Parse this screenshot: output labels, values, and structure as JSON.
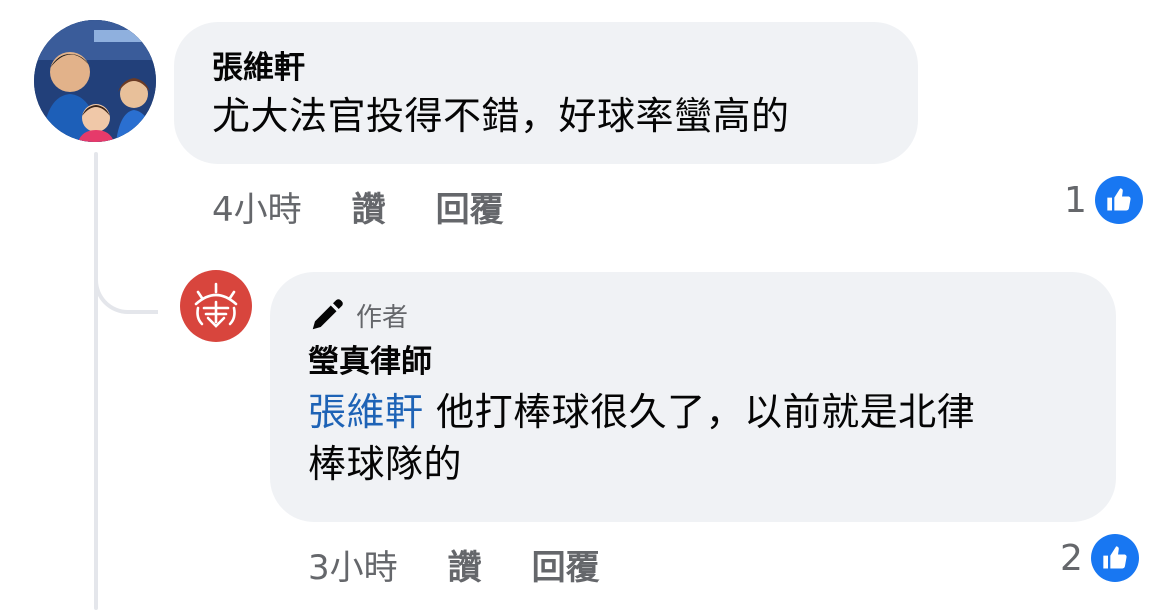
{
  "comment": {
    "author": "張維軒",
    "text": "尤大法官投得不錯，好球率蠻高的",
    "time": "4小時",
    "like_label": "讚",
    "reply_label": "回覆",
    "reaction_count": "1"
  },
  "reply": {
    "badge_label": "作者",
    "author": "瑩真律師",
    "mention": "張維軒",
    "text_line1": " 他打棒球很久了，以前就是北律",
    "text_line2": "棒球隊的",
    "time": "3小時",
    "like_label": "讚",
    "reply_label": "回覆",
    "reaction_count": "2"
  },
  "colors": {
    "bubble": "#f0f2f5",
    "mention": "#1e63b6",
    "like_blue": "#1877f2",
    "meta_gray": "#65676b",
    "avatar_red": "#d8453d"
  },
  "icons": [
    "avatar-photo",
    "firm-logo-icon",
    "pen-icon",
    "thumbs-up-icon"
  ]
}
